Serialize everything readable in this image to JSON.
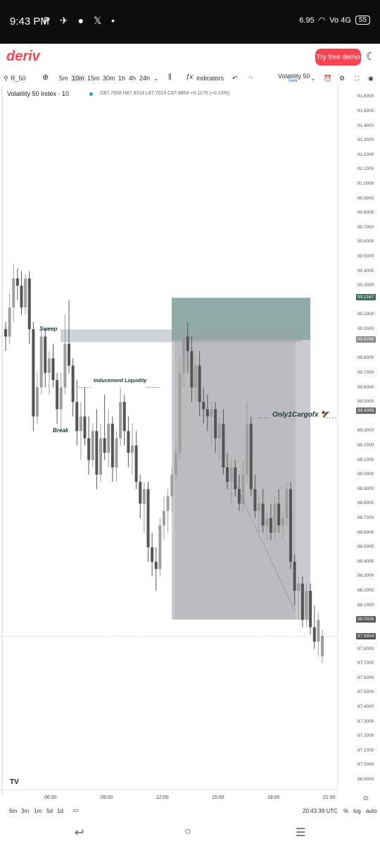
{
  "statusbar": {
    "time": "9:43 PM",
    "notifications": "P ✈ ● 𝕏 •",
    "speed": "6.95",
    "network": "Vo 4G",
    "battery": "55"
  },
  "app": {
    "logo": "deriv",
    "demo_button": "Try free demo",
    "theme_icon": "moon-icon"
  },
  "toolbar": {
    "symbol": "R_50",
    "timeframes": [
      "5m",
      "10m",
      "15m",
      "30m",
      "1h",
      "4h",
      "24h"
    ],
    "active_timeframe": "10m",
    "indicators_label": "Indicators",
    "layout_name": "Volatility 50",
    "layout_status": "Save"
  },
  "legend": {
    "title": "Volatility 50 Index · 10",
    "open": "O87.7508",
    "high": "H87.9318",
    "low": "L87.7023",
    "close": "C87.8854",
    "change": "+0.1176 (+0.13%)"
  },
  "annotations": {
    "sweep": "Sweep",
    "inducement": "Inducement Liquidity",
    "break": "Break",
    "watermark": "Only1Cargofx 🦅"
  },
  "price_axis": {
    "labels": [
      "91.6000",
      "91.5000",
      "91.4000",
      "91.3000",
      "91.2000",
      "91.1000",
      "91.0000",
      "90.9000",
      "90.8000",
      "90.7000",
      "90.6000",
      "90.5000",
      "90.4000",
      "90.3000",
      "90.1000",
      "90.0000",
      "89.8000",
      "89.7000",
      "89.6000",
      "89.5000",
      "89.3000",
      "89.2000",
      "89.1000",
      "89.0000",
      "88.9000",
      "88.8000",
      "88.7000",
      "88.6000",
      "88.5000",
      "88.4000",
      "88.3000",
      "88.2000",
      "88.1000",
      "87.8000",
      "87.7000",
      "87.6000",
      "87.5000",
      "87.4000",
      "87.3000",
      "87.2000",
      "87.1000",
      "87.0000",
      "86.9000"
    ],
    "badges": [
      {
        "label": "90.2167",
        "color": "#3d6b5f"
      },
      {
        "label": "89.9266",
        "color": "#8a8a8a"
      },
      {
        "label": "89.4399",
        "color": "#666666"
      },
      {
        "label": "88.0026",
        "color": "#555555"
      },
      {
        "label": "87.8854",
        "color": "#555555"
      }
    ]
  },
  "time_axis": [
    "06:00",
    "09:00",
    "12:00",
    "15:00",
    "18:00",
    "21:00"
  ],
  "bottom": {
    "ranges": [
      "6m",
      "3m",
      "1m",
      "5d",
      "1d"
    ],
    "clock": "20:43:39 UTC",
    "percent": "%",
    "log": "log",
    "auto": "auto"
  },
  "chart_data": {
    "type": "candlestick",
    "title": "Volatility 50 Index · 10",
    "ylim": [
      86.9,
      91.65
    ],
    "x_ticks": [
      "06:00",
      "09:00",
      "12:00",
      "15:00",
      "18:00",
      "21:00"
    ],
    "position": {
      "entry": 89.9266,
      "stop": 90.2167,
      "target": 88.0026
    },
    "sweep_level": 89.97,
    "inducement_level": 89.6,
    "watermark_level": 89.39,
    "candles": [
      [
        90.0,
        90.05,
        89.85,
        89.95
      ],
      [
        89.95,
        90.25,
        89.9,
        90.15
      ],
      [
        90.15,
        90.45,
        90.05,
        90.35
      ],
      [
        90.35,
        90.42,
        90.2,
        90.3
      ],
      [
        90.3,
        90.4,
        90.1,
        90.15
      ],
      [
        90.15,
        90.38,
        90.1,
        90.35
      ],
      [
        90.35,
        90.4,
        89.9,
        90.0
      ],
      [
        90.0,
        90.05,
        89.3,
        89.4
      ],
      [
        89.4,
        89.7,
        89.35,
        89.6
      ],
      [
        89.6,
        90.0,
        89.55,
        89.95
      ],
      [
        89.95,
        90.0,
        89.6,
        89.7
      ],
      [
        89.7,
        89.85,
        89.55,
        89.8
      ],
      [
        89.8,
        89.9,
        89.6,
        89.65
      ],
      [
        89.65,
        89.7,
        89.35,
        89.45
      ],
      [
        89.45,
        89.7,
        89.3,
        89.6
      ],
      [
        89.6,
        90.1,
        89.55,
        89.9
      ],
      [
        89.9,
        90.2,
        89.7,
        89.75
      ],
      [
        89.75,
        89.8,
        89.4,
        89.5
      ],
      [
        89.5,
        89.65,
        89.2,
        89.3
      ],
      [
        89.3,
        89.5,
        89.1,
        89.4
      ],
      [
        89.4,
        89.6,
        89.2,
        89.25
      ],
      [
        89.25,
        89.4,
        89.0,
        89.1
      ],
      [
        89.1,
        89.35,
        89.05,
        89.3
      ],
      [
        89.3,
        89.45,
        88.9,
        89.0
      ],
      [
        89.0,
        89.35,
        88.95,
        89.25
      ],
      [
        89.25,
        89.55,
        89.1,
        89.15
      ],
      [
        89.15,
        89.45,
        89.05,
        89.35
      ],
      [
        89.35,
        89.4,
        88.95,
        89.05
      ],
      [
        89.05,
        89.3,
        88.95,
        89.25
      ],
      [
        89.25,
        89.6,
        89.2,
        89.5
      ],
      [
        89.5,
        89.55,
        89.2,
        89.3
      ],
      [
        89.3,
        89.4,
        89.05,
        89.15
      ],
      [
        89.15,
        89.35,
        89.0,
        89.2
      ],
      [
        89.2,
        89.3,
        88.9,
        88.95
      ],
      [
        88.95,
        89.0,
        88.7,
        88.8
      ],
      [
        88.8,
        88.95,
        88.6,
        88.9
      ],
      [
        88.9,
        88.95,
        88.4,
        88.5
      ],
      [
        88.5,
        88.6,
        88.3,
        88.4
      ],
      [
        88.4,
        88.5,
        88.2,
        88.35
      ],
      [
        88.35,
        88.7,
        88.3,
        88.65
      ],
      [
        88.65,
        88.85,
        88.55,
        88.75
      ],
      [
        88.75,
        88.9,
        88.6,
        88.85
      ],
      [
        88.85,
        89.05,
        88.75,
        89.0
      ],
      [
        89.0,
        89.2,
        88.95,
        89.15
      ],
      [
        89.15,
        89.8,
        89.1,
        89.7
      ],
      [
        89.7,
        90.05,
        89.6,
        89.95
      ],
      [
        89.95,
        90.05,
        89.7,
        89.85
      ],
      [
        89.85,
        89.95,
        89.5,
        89.6
      ],
      [
        89.6,
        89.8,
        89.5,
        89.75
      ],
      [
        89.75,
        89.85,
        89.4,
        89.5
      ],
      [
        89.5,
        89.6,
        89.35,
        89.45
      ],
      [
        89.45,
        89.55,
        89.3,
        89.4
      ],
      [
        89.4,
        89.5,
        89.2,
        89.45
      ],
      [
        89.45,
        89.5,
        89.15,
        89.25
      ],
      [
        89.25,
        89.4,
        89.1,
        89.35
      ],
      [
        89.35,
        89.45,
        89.0,
        89.05
      ],
      [
        89.05,
        89.15,
        88.9,
        88.95
      ],
      [
        88.95,
        89.1,
        88.8,
        89.05
      ],
      [
        89.05,
        89.1,
        88.85,
        88.9
      ],
      [
        88.9,
        89.0,
        88.75,
        88.8
      ],
      [
        88.8,
        89.1,
        88.75,
        89.0
      ],
      [
        89.0,
        89.5,
        88.95,
        89.35
      ],
      [
        89.35,
        89.4,
        88.85,
        88.9
      ],
      [
        88.9,
        89.0,
        88.7,
        88.75
      ],
      [
        88.75,
        88.85,
        88.6,
        88.8
      ],
      [
        88.8,
        88.9,
        88.6,
        88.65
      ],
      [
        88.65,
        88.75,
        88.55,
        88.7
      ],
      [
        88.7,
        88.8,
        88.55,
        88.6
      ],
      [
        88.6,
        88.85,
        88.55,
        88.8
      ],
      [
        88.8,
        88.9,
        88.6,
        88.65
      ],
      [
        88.65,
        88.75,
        88.55,
        88.7
      ],
      [
        88.7,
        88.95,
        88.65,
        88.9
      ],
      [
        88.9,
        88.95,
        88.35,
        88.4
      ],
      [
        88.4,
        88.45,
        88.1,
        88.2
      ],
      [
        88.2,
        88.3,
        88.0,
        88.25
      ],
      [
        88.25,
        88.3,
        87.95,
        88.0
      ],
      [
        88.0,
        88.25,
        87.95,
        88.2
      ],
      [
        88.2,
        88.25,
        87.9,
        87.95
      ],
      [
        87.95,
        88.1,
        87.8,
        87.85
      ],
      [
        87.85,
        88.05,
        87.75,
        88.0
      ],
      [
        87.75,
        87.93,
        87.7,
        87.89
      ]
    ]
  }
}
